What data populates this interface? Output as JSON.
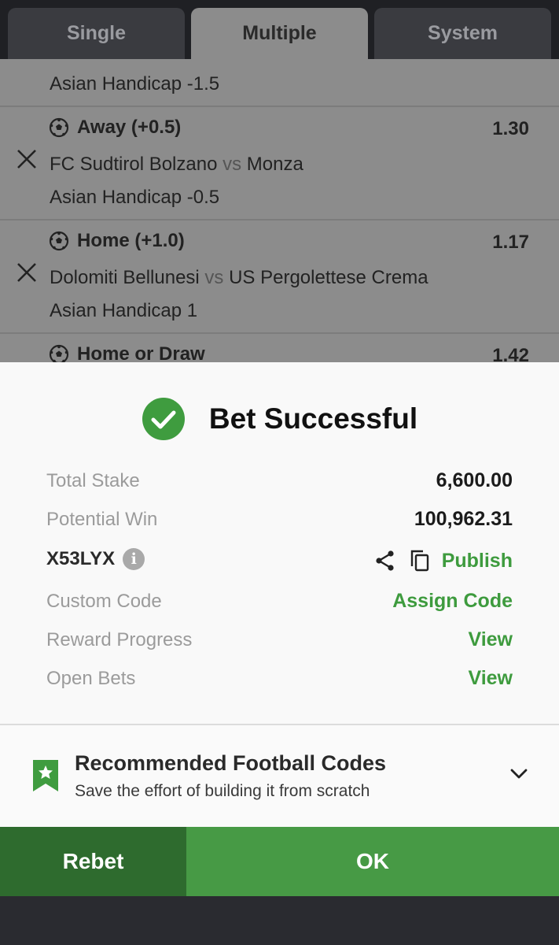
{
  "tabs": {
    "single": "Single",
    "multiple": "Multiple",
    "system": "System"
  },
  "bets": {
    "top_market": "Asian Handicap -1.5",
    "b1": {
      "selection": "Away (+0.5)",
      "odds": "1.30",
      "home": "FC Sudtirol Bolzano",
      "vs": "vs",
      "away": "Monza",
      "market": "Asian Handicap -0.5"
    },
    "b2": {
      "selection": "Home (+1.0)",
      "odds": "1.17",
      "home": "Dolomiti Bellunesi",
      "vs": "vs",
      "away": "US Pergolettese Crema",
      "market": "Asian Handicap 1"
    },
    "b3": {
      "selection": "Home or Draw",
      "odds": "1.42"
    }
  },
  "success": {
    "title": "Bet Successful",
    "total_stake_label": "Total Stake",
    "total_stake_value": "6,600.00",
    "potential_win_label": "Potential Win",
    "potential_win_value": "100,962.31",
    "booking_code": "X53LYX",
    "publish_label": "Publish",
    "custom_code_label": "Custom Code",
    "assign_code_label": "Assign Code",
    "reward_progress_label": "Reward Progress",
    "open_bets_label": "Open Bets",
    "view_label": "View"
  },
  "recommended": {
    "title": "Recommended Football Codes",
    "subtitle": "Save the effort of building it from scratch"
  },
  "buttons": {
    "rebet": "Rebet",
    "ok": "OK"
  },
  "colors": {
    "accent_green": "#3e9b3e",
    "button_green": "#479a45",
    "rebet_green": "#2e6b2e",
    "success_icon": "#3f9c3f"
  },
  "icons": {
    "sport": "football-icon",
    "remove": "close-icon",
    "success": "check-circle-icon",
    "info": "info-icon",
    "share": "share-icon",
    "copy": "copy-icon",
    "bookmark": "bookmark-star-icon",
    "expand": "chevron-down-icon"
  }
}
